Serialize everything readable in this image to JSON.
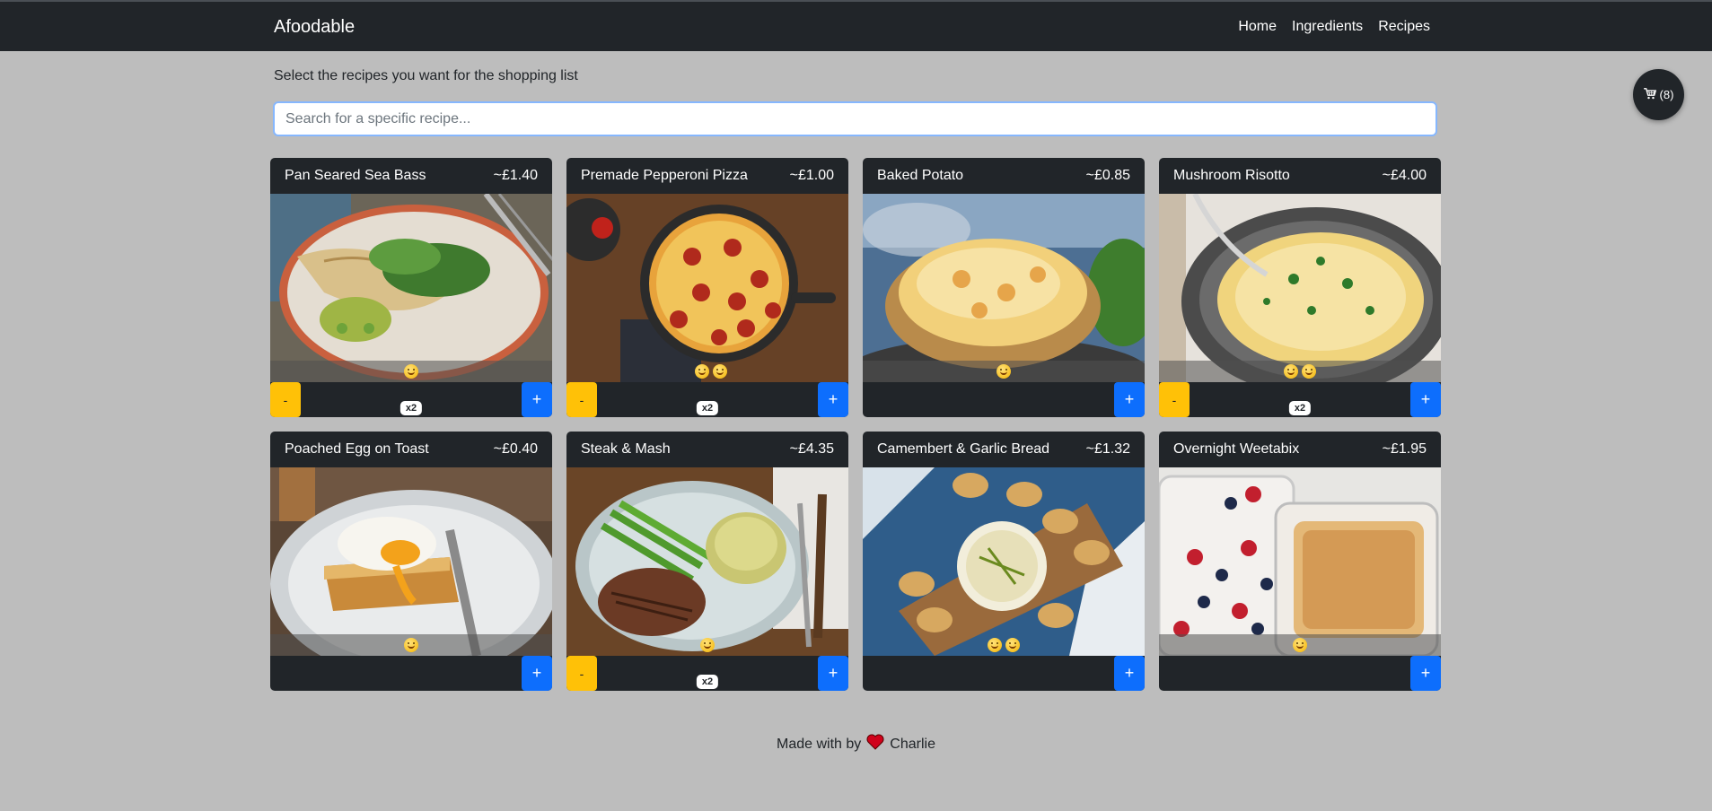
{
  "nav": {
    "brand": "Afoodable",
    "links": [
      "Home",
      "Ingredients",
      "Recipes"
    ]
  },
  "cart": {
    "label": "(8)",
    "icon": "cart-icon"
  },
  "intro": "Select the recipes you want for the shopping list",
  "search": {
    "placeholder": "Search for a specific recipe...",
    "value": ""
  },
  "recipes": [
    {
      "name": "Pan Seared Sea Bass",
      "price": "~£1.40",
      "qty": "x2",
      "faces": 1,
      "show_minus": true,
      "image": "sea-bass-image"
    },
    {
      "name": "Premade Pepperoni Pizza",
      "price": "~£1.00",
      "qty": "x2",
      "faces": 2,
      "show_minus": true,
      "image": "pizza-image"
    },
    {
      "name": "Baked Potato",
      "price": "~£0.85",
      "qty": "",
      "faces": 1,
      "show_minus": false,
      "image": "baked-potato-image"
    },
    {
      "name": "Mushroom Risotto",
      "price": "~£4.00",
      "qty": "x2",
      "faces": 2,
      "show_minus": true,
      "image": "risotto-image"
    },
    {
      "name": "Poached Egg on Toast",
      "price": "~£0.40",
      "qty": "",
      "faces": 1,
      "show_minus": false,
      "image": "egg-toast-image"
    },
    {
      "name": "Steak & Mash",
      "price": "~£4.35",
      "qty": "x2",
      "faces": 1,
      "show_minus": true,
      "image": "steak-mash-image"
    },
    {
      "name": "Camembert & Garlic Bread",
      "price": "~£1.32",
      "qty": "",
      "faces": 2,
      "show_minus": false,
      "image": "camembert-image"
    },
    {
      "name": "Overnight Weetabix",
      "price": "~£1.95",
      "qty": "",
      "faces": 1,
      "show_minus": false,
      "image": "weetabix-image"
    }
  ],
  "buttons": {
    "minus": "-",
    "plus": "+"
  },
  "footer": {
    "prefix": "Made with by",
    "author": "Charlie"
  },
  "colors": {
    "navbar": "#212529",
    "page_bg": "#bdbdbd",
    "minus": "#ffc107",
    "plus": "#0d6efd",
    "heart": "#d0021b"
  }
}
